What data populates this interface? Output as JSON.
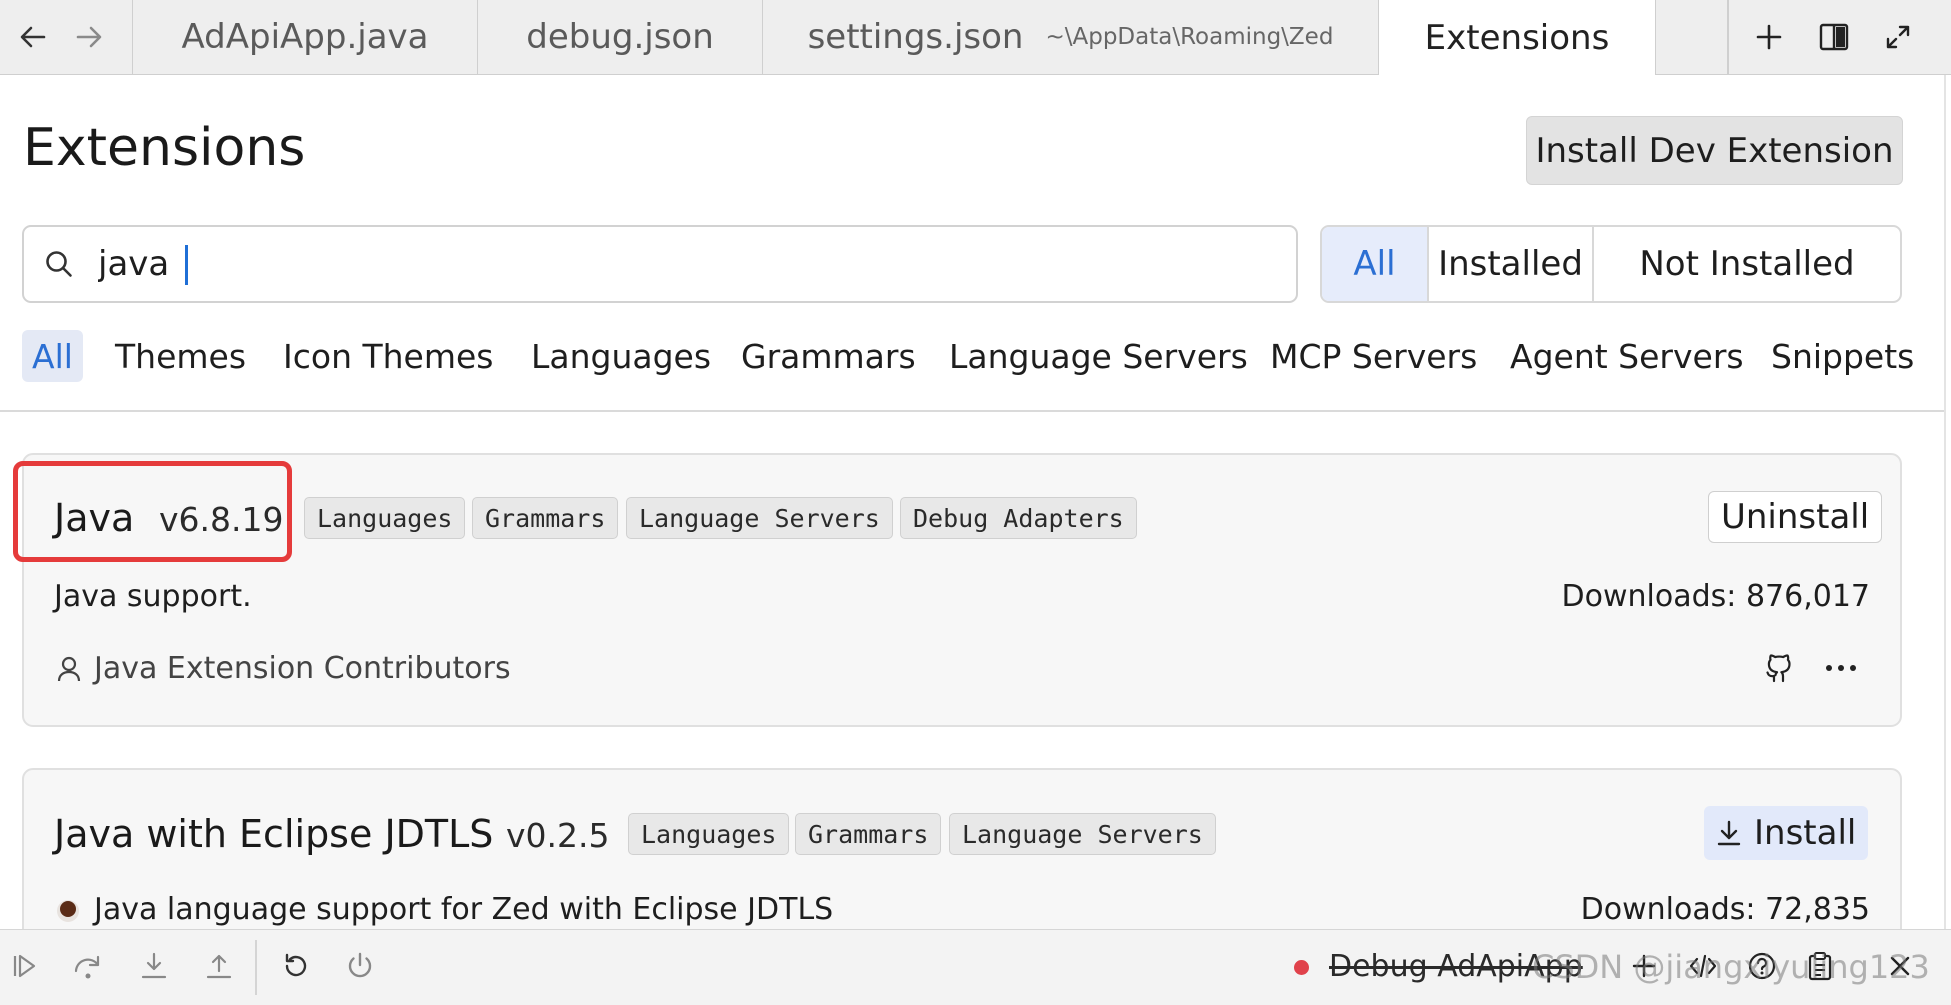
{
  "tabbar": {
    "tabs": [
      {
        "label": "AdApiApp.java",
        "path": ""
      },
      {
        "label": "debug.json",
        "path": ""
      },
      {
        "label": "settings.json",
        "path": "~\\AppData\\Roaming\\Zed"
      },
      {
        "label": "Extensions",
        "path": ""
      }
    ],
    "active_tab": "Extensions"
  },
  "page": {
    "title": "Extensions",
    "install_dev_label": "Install Dev Extension"
  },
  "search": {
    "value": "java",
    "placeholder": ""
  },
  "filters": [
    "All",
    "Installed",
    "Not Installed"
  ],
  "active_filter": "All",
  "categories": [
    "All",
    "Themes",
    "Icon Themes",
    "Languages",
    "Grammars",
    "Language Servers",
    "MCP Servers",
    "Agent Servers",
    "Snippets"
  ],
  "active_category": "All",
  "extensions": [
    {
      "name": "Java",
      "version": "v6.8.19",
      "badges": [
        "Languages",
        "Grammars",
        "Language Servers",
        "Debug Adapters"
      ],
      "description": "Java support.",
      "downloads": "Downloads: 876,017",
      "author": "Java Extension Contributors",
      "action": "Uninstall",
      "installed": true
    },
    {
      "name": "Java with Eclipse JDTLS",
      "version": "v0.2.5",
      "badges": [
        "Languages",
        "Grammars",
        "Language Servers"
      ],
      "description": "Java language support for Zed with Eclipse JDTLS",
      "downloads": "Downloads: 72,835",
      "action": "Install",
      "installed": false
    }
  ],
  "statusbar": {
    "debug_label": "Debug AdApiApp",
    "watermark": "CSDN @jiangxiyuling123"
  },
  "colors": {
    "accent": "#2b6fd3",
    "highlight_box": "#e53b3b",
    "debug_dot": "#e0424b",
    "active_filter_bg": "#e6ecfb"
  },
  "icons": [
    "arrow-left-icon",
    "arrow-right-icon",
    "plus-icon",
    "split-pane-icon",
    "maximize-icon",
    "search-icon",
    "user-icon",
    "github-icon",
    "more-icon",
    "download-icon",
    "coffee-icon",
    "continue-icon",
    "step-over-icon",
    "step-into-icon",
    "step-out-icon",
    "restart-icon",
    "power-icon",
    "code-icon",
    "help-icon",
    "debug-clipboard-icon",
    "close-icon"
  ]
}
